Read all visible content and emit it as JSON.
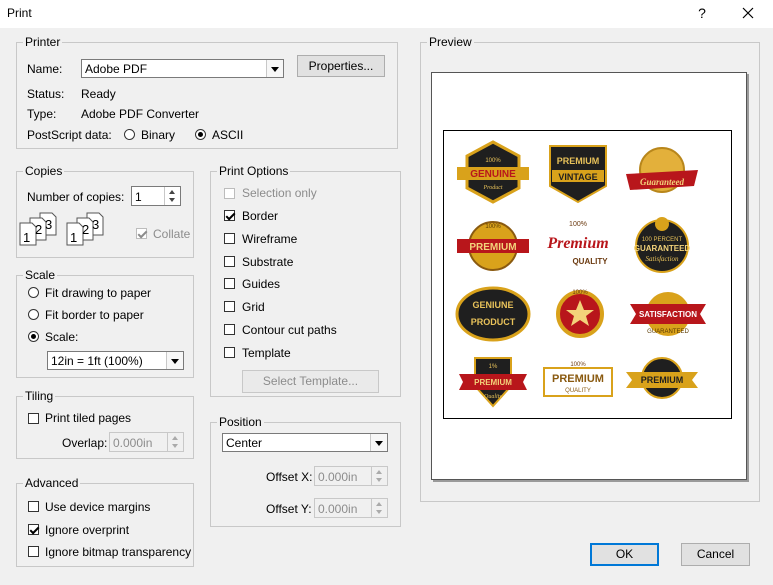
{
  "window": {
    "title": "Print",
    "help": "?",
    "close": "✕"
  },
  "printer": {
    "legend": "Printer",
    "name_label": "Name:",
    "name_value": "Adobe PDF",
    "properties_label": "Properties...",
    "status_label": "Status:",
    "status_value": "Ready",
    "type_label": "Type:",
    "type_value": "Adobe PDF Converter",
    "postscript_label": "PostScript data:",
    "binary_label": "Binary",
    "ascii_label": "ASCII",
    "selected": "ASCII"
  },
  "copies": {
    "legend": "Copies",
    "number_label": "Number of copies:",
    "number_value": "1",
    "collate_label": "Collate",
    "collate_checked": true
  },
  "scale": {
    "legend": "Scale",
    "fit_drawing": "Fit drawing to paper",
    "fit_border": "Fit border to paper",
    "scale_label": "Scale:",
    "scale_value": "12in = 1ft (100%)",
    "selected": "Scale"
  },
  "tiling": {
    "legend": "Tiling",
    "print_tiled": "Print tiled pages",
    "overlap_label": "Overlap:",
    "overlap_value": "0.000in"
  },
  "advanced": {
    "legend": "Advanced",
    "device_margins": "Use device margins",
    "ignore_overprint": "Ignore overprint",
    "ignore_bitmap": "Ignore bitmap transparency"
  },
  "print_options": {
    "legend": "Print Options",
    "selection_only": "Selection only",
    "border": "Border",
    "wireframe": "Wireframe",
    "substrate": "Substrate",
    "guides": "Guides",
    "grid": "Grid",
    "contour": "Contour cut paths",
    "template": "Template",
    "select_template": "Select Template..."
  },
  "position": {
    "legend": "Position",
    "value": "Center",
    "offset_x_label": "Offset X:",
    "offset_x_value": "0.000in",
    "offset_y_label": "Offset Y:",
    "offset_y_value": "0.000in"
  },
  "preview": {
    "legend": "Preview",
    "badges": [
      "100%",
      "GENUINE",
      "Product",
      "PREMIUM",
      "VINTAGE",
      "Guaranteed",
      "100%",
      "PREMIUM",
      "100%",
      "Premium",
      "QUALITY",
      "100 PERCENT",
      "GUARANTEED",
      "Satisfaction",
      "GENIUNE",
      "PRODUCT",
      "100%",
      "SATISFACTION",
      "GUARANTEED",
      "1%",
      "PREMIUM",
      "Quality",
      "100%",
      "PREMIUM",
      "QUALITY",
      "PREMIUM"
    ]
  },
  "buttons": {
    "ok": "OK",
    "cancel": "Cancel"
  },
  "colors": {
    "gold": "#d9a21b",
    "red": "#b8161b",
    "dark": "#1f1f1f",
    "focus": "#0078d7"
  }
}
